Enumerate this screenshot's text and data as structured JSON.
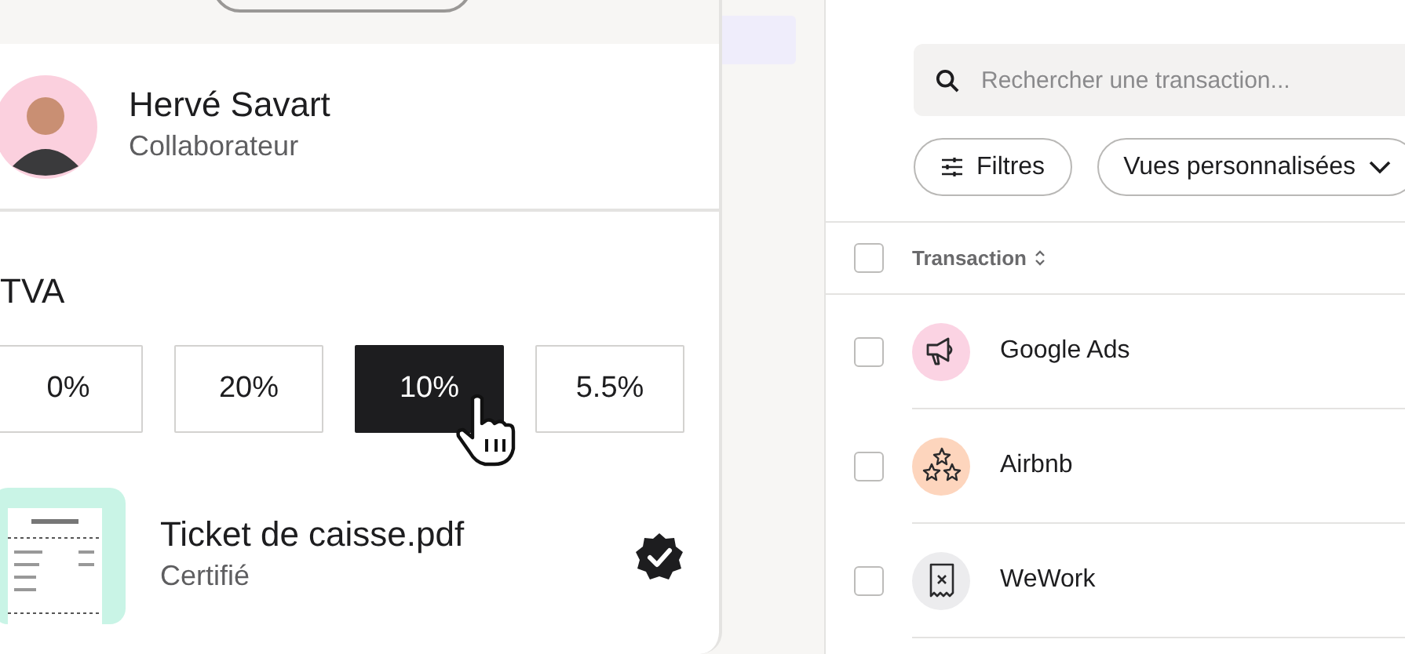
{
  "profile": {
    "name": "Hervé Savart",
    "role": "Collaborateur"
  },
  "vat": {
    "title": "TVA",
    "options": [
      {
        "label": "0%",
        "selected": false
      },
      {
        "label": "20%",
        "selected": false
      },
      {
        "label": "10%",
        "selected": true
      },
      {
        "label": "5.5%",
        "selected": false
      }
    ]
  },
  "document": {
    "name": "Ticket de caisse.pdf",
    "status": "Certifié",
    "certified": true
  },
  "search": {
    "placeholder": "Rechercher une transaction..."
  },
  "filters": [
    {
      "label": "Filtres",
      "kind": "filter"
    },
    {
      "label": "Vues personnalisées",
      "kind": "dropdown"
    }
  ],
  "table": {
    "columns": [
      "Transaction"
    ],
    "select_all_checked": false,
    "rows": [
      {
        "name": "Google Ads",
        "color": "#fbd3e3",
        "checked": false
      },
      {
        "name": "Airbnb",
        "color": "#fdd5bd",
        "checked": false
      },
      {
        "name": "WeWork",
        "color": "#ececee",
        "checked": false
      }
    ]
  }
}
